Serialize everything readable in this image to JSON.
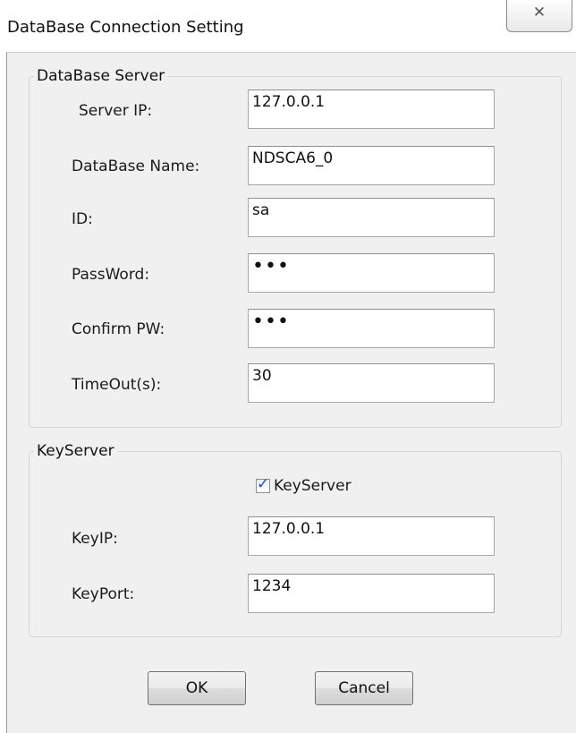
{
  "window": {
    "title": "DataBase Connection Setting",
    "close_glyph": "✕"
  },
  "db_group": {
    "label": "DataBase Server",
    "server_ip_label": "Server IP:",
    "server_ip_value": "127.0.0.1",
    "db_name_label": "DataBase Name:",
    "db_name_value": "NDSCA6_0",
    "id_label": "ID:",
    "id_value": "sa",
    "password_label": "PassWord:",
    "password_value": "•••",
    "confirm_label": "Confirm PW:",
    "confirm_value": "•••",
    "timeout_label": "TimeOut(s):",
    "timeout_value": "30"
  },
  "key_group": {
    "label": "KeyServer",
    "checkbox_label": "KeyServer",
    "checkbox_checked": true,
    "key_ip_label": "KeyIP:",
    "key_ip_value": "127.0.0.1",
    "key_port_label": "KeyPort:",
    "key_port_value": "1234"
  },
  "buttons": {
    "ok": "OK",
    "cancel": "Cancel"
  }
}
